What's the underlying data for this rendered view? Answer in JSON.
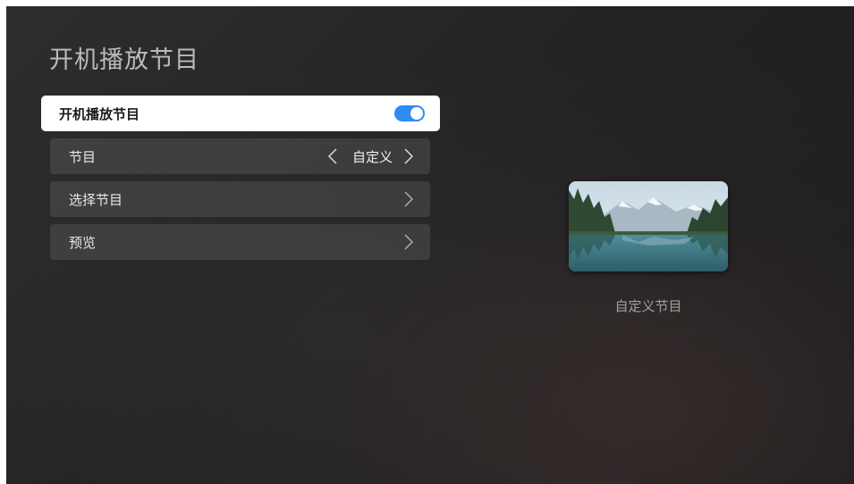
{
  "page": {
    "title": "开机播放节目"
  },
  "settings": {
    "boot_play": {
      "label": "开机播放节目",
      "enabled": true
    },
    "program": {
      "label": "节目",
      "value": "自定义"
    },
    "select_program": {
      "label": "选择节目"
    },
    "preview": {
      "label": "预览"
    }
  },
  "preview_card": {
    "caption": "自定义节目",
    "image": "mountain-lake-landscape"
  },
  "colors": {
    "toggle_on": "#2e8bf5",
    "focused_row": "#ffffff"
  }
}
